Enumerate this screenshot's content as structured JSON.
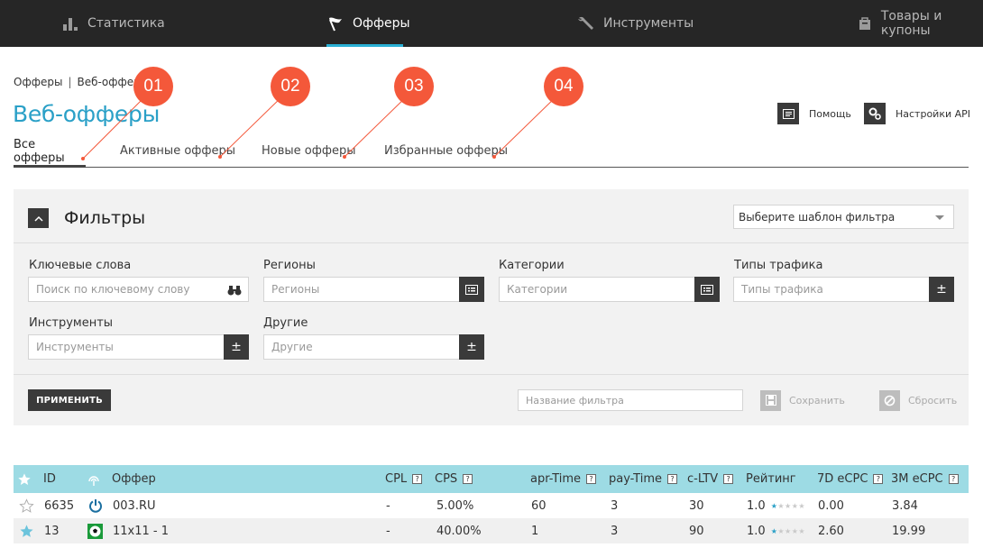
{
  "nav": {
    "items": [
      {
        "label": "Статистика",
        "icon": "bar-chart-icon",
        "active": false
      },
      {
        "label": "Офферы",
        "icon": "flag-icon",
        "active": true
      },
      {
        "label": "Инструменты",
        "icon": "wrench-icon",
        "active": false
      },
      {
        "label": "Товары и купоны",
        "icon": "bag-icon",
        "active": false
      }
    ]
  },
  "breadcrumb": {
    "items": [
      "Офферы",
      "Веб-офферы"
    ],
    "separator": "|"
  },
  "page": {
    "title": "Веб-офферы",
    "help_label": "Помощь",
    "api_label": "Настройки API"
  },
  "tabs": [
    "Все офферы",
    "Активные офферы",
    "Новые офферы",
    "Избранные офферы"
  ],
  "callouts": [
    "01",
    "02",
    "03",
    "04"
  ],
  "filters": {
    "title": "Фильтры",
    "template_placeholder": "Выберите шаблон фильтра",
    "keywords": {
      "label": "Ключевые слова",
      "placeholder": "Поиск по ключевому слову"
    },
    "regions": {
      "label": "Регионы",
      "placeholder": "Регионы"
    },
    "categories": {
      "label": "Категории",
      "placeholder": "Категории"
    },
    "traffic": {
      "label": "Типы трафика",
      "placeholder": "Типы трафика"
    },
    "tools": {
      "label": "Инструменты",
      "placeholder": "Инструменты"
    },
    "other": {
      "label": "Другие",
      "placeholder": "Другие"
    },
    "apply_label": "ПРИМЕНИТЬ",
    "filter_name_placeholder": "Название фильтра",
    "save_label": "Сохранить",
    "reset_label": "Сбросить"
  },
  "table": {
    "headers": {
      "id": "ID",
      "offer": "Оффер",
      "cpl": "CPL",
      "cps": "CPS",
      "apr_time": "apr-Time",
      "pay_time": "pay-Time",
      "c_ltv": "c-LTV",
      "rating": "Рейтинг",
      "ecpc7": "7D eCPC",
      "ecpc3m": "3M eCPC"
    },
    "help_mark": "?",
    "rows": [
      {
        "favorite": false,
        "id": "6635",
        "offer": "003.RU",
        "logo": "power-logo-icon",
        "cpl": "-",
        "cps": "5.00%",
        "apr_time": "60",
        "pay_time": "3",
        "c_ltv": "30",
        "rating": "1.0",
        "rating_stars": 1,
        "ecpc7": "0.00",
        "ecpc3m": "3.84"
      },
      {
        "favorite": true,
        "id": "13",
        "offer": "11x11 - 1",
        "logo": "soccer-logo-icon",
        "cpl": "-",
        "cps": "40.00%",
        "apr_time": "1",
        "pay_time": "3",
        "c_ltv": "90",
        "rating": "1.0",
        "rating_stars": 1,
        "ecpc7": "2.60",
        "ecpc3m": "19.99"
      }
    ]
  },
  "colors": {
    "accent": "#2aa0c7",
    "callout": "#f4583a",
    "table_header": "#9ddbe4",
    "nav_bg": "#262626"
  }
}
